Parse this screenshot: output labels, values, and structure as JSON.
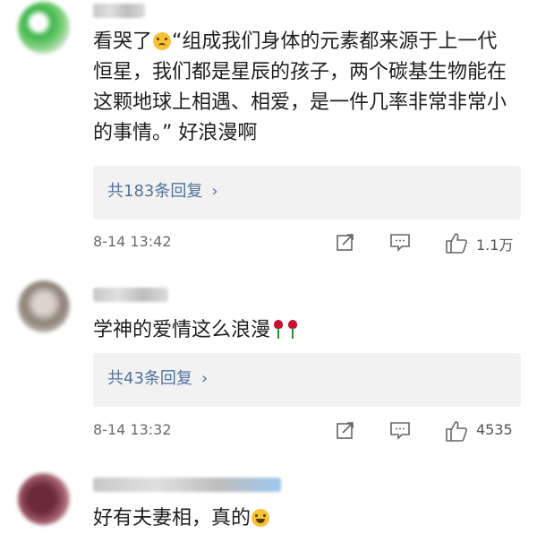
{
  "comments": [
    {
      "text_before_emoji": "看哭了",
      "text_after_emoji": "“组成我们身体的元素都来源于上一代恒星，我们都是星辰的孩子，两个碳基生物能在这颗地球上相遇、相爱，是一件几率非常非常小的事情。” 好浪漫啊",
      "replies": "共183条回复",
      "time": "8-14 13:42",
      "likes": "1.1万"
    },
    {
      "text": "学神的爱情这么浪漫",
      "replies": "共43条回复",
      "time": "8-14 13:32",
      "likes": "4535"
    },
    {
      "text": "好有夫妻相，真的"
    }
  ],
  "icons": {
    "share": "share-icon",
    "comment": "comment-icon",
    "like": "thumbs-up-icon",
    "chevron": "›"
  },
  "colors": {
    "link": "#51729e",
    "reply_bg": "#f2f2f2",
    "meta_text": "#6b6b6b"
  }
}
